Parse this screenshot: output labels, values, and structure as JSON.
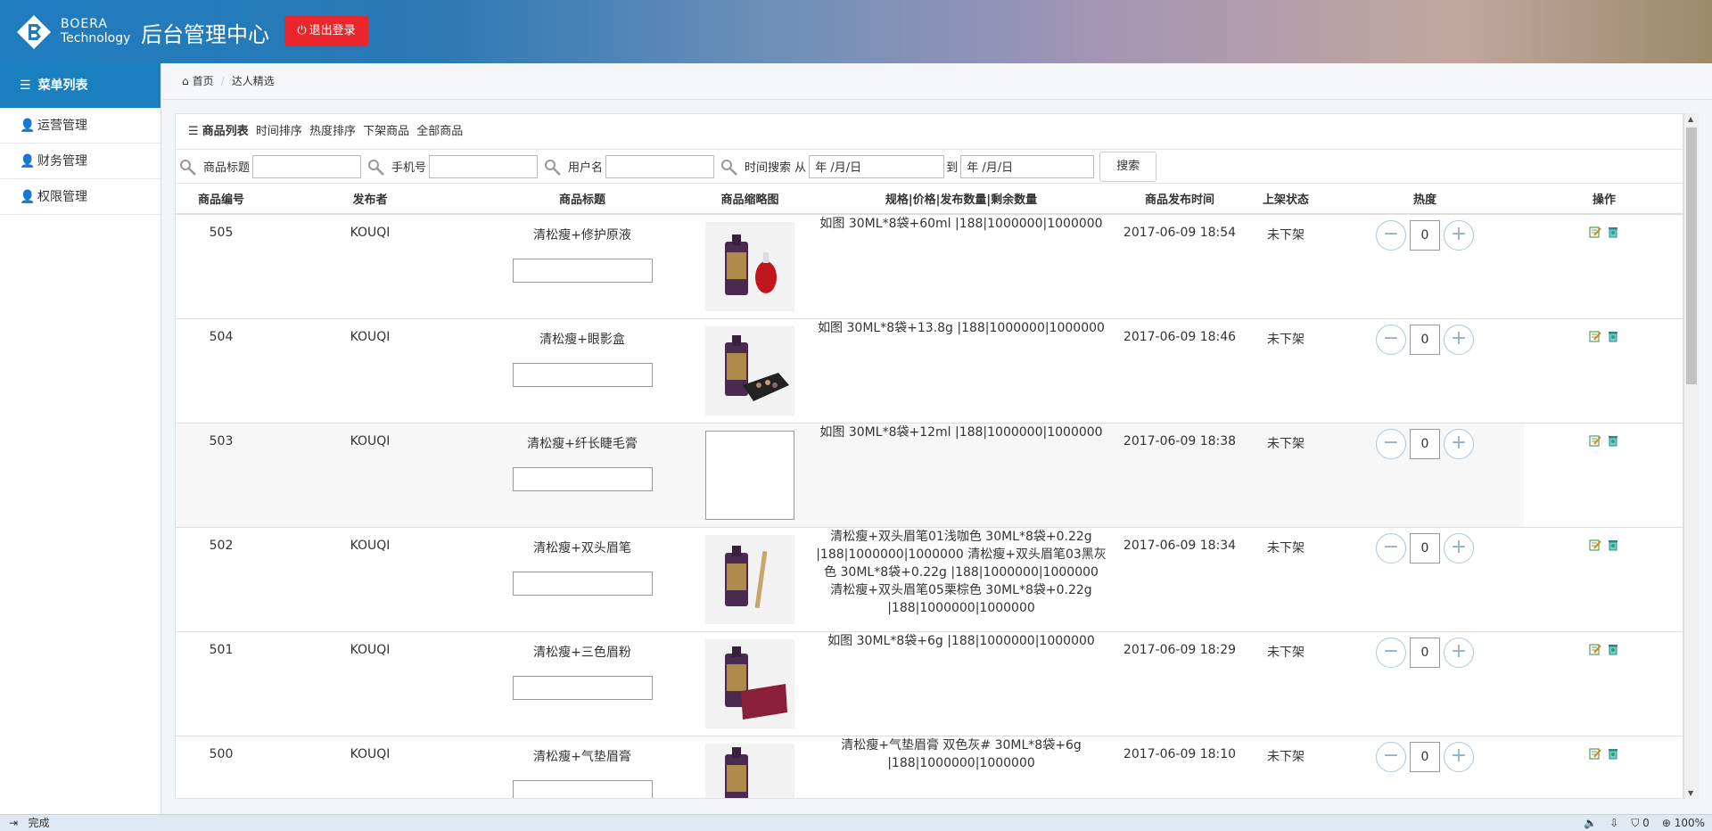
{
  "header": {
    "logo_line1": "BOERA",
    "logo_line2": "Technology",
    "title": "后台管理中心",
    "logout_label": "退出登录"
  },
  "sidebar": {
    "menu_title": "菜单列表",
    "items": [
      {
        "label": "运营管理"
      },
      {
        "label": "财务管理"
      },
      {
        "label": "权限管理"
      }
    ]
  },
  "breadcrumb": {
    "home": "首页",
    "current": "达人精选"
  },
  "panel": {
    "title": "商品列表",
    "links": [
      "时间排序",
      "热度排序",
      "下架商品",
      "全部商品"
    ]
  },
  "search": {
    "title_label": "商品标题",
    "phone_label": "手机号",
    "username_label": "用户名",
    "time_label": "时间搜索 从",
    "date_from": "年 /月/日",
    "to_label": "到",
    "date_to": "年 /月/日",
    "button": "搜索"
  },
  "table": {
    "headers": [
      "商品编号",
      "发布者",
      "商品标题",
      "商品缩略图",
      "规格|价格|发布数量|剩余数量",
      "商品发布时间",
      "上架状态",
      "热度",
      "操作"
    ],
    "rows": [
      {
        "id": "505",
        "publisher": "KOUQI",
        "title": "清松瘦+修护原液",
        "spec": "如图 30ML*8袋+60ml |188|1000000|1000000",
        "time": "2017-06-09 18:54",
        "status": "未下架",
        "heat": "0",
        "thumb": "bottle"
      },
      {
        "id": "504",
        "publisher": "KOUQI",
        "title": "清松瘦+眼影盒",
        "spec": "如图 30ML*8袋+13.8g |188|1000000|1000000",
        "time": "2017-06-09 18:46",
        "status": "未下架",
        "heat": "0",
        "thumb": "palette"
      },
      {
        "id": "503",
        "publisher": "KOUQI",
        "title": "清松瘦+纤长睫毛膏",
        "spec": "如图 30ML*8袋+12ml |188|1000000|1000000",
        "time": "2017-06-09 18:38",
        "status": "未下架",
        "heat": "0",
        "thumb": "broken"
      },
      {
        "id": "502",
        "publisher": "KOUQI",
        "title": "清松瘦+双头眉笔",
        "spec": "清松瘦+双头眉笔01浅咖色 30ML*8袋+0.22g |188|1000000|1000000 清松瘦+双头眉笔03黑灰色 30ML*8袋+0.22g |188|1000000|1000000 清松瘦+双头眉笔05栗棕色 30ML*8袋+0.22g |188|1000000|1000000",
        "time": "2017-06-09 18:34",
        "status": "未下架",
        "heat": "0",
        "thumb": "pencil"
      },
      {
        "id": "501",
        "publisher": "KOUQI",
        "title": "清松瘦+三色眉粉",
        "spec": "如图 30ML*8袋+6g |188|1000000|1000000",
        "time": "2017-06-09 18:29",
        "status": "未下架",
        "heat": "0",
        "thumb": "compact"
      },
      {
        "id": "500",
        "publisher": "KOUQI",
        "title": "清松瘦+气垫眉膏",
        "spec": "清松瘦+气垫眉膏 双色灰# 30ML*8袋+6g |188|1000000|1000000",
        "time": "2017-06-09 18:10",
        "status": "未下架",
        "heat": "0",
        "thumb": "pouch"
      }
    ]
  },
  "statusbar": {
    "left": "完成",
    "count": "0",
    "zoom": "100%"
  },
  "colors": {
    "logout": "#e8262b",
    "menu_active": "#1a7fbf"
  }
}
